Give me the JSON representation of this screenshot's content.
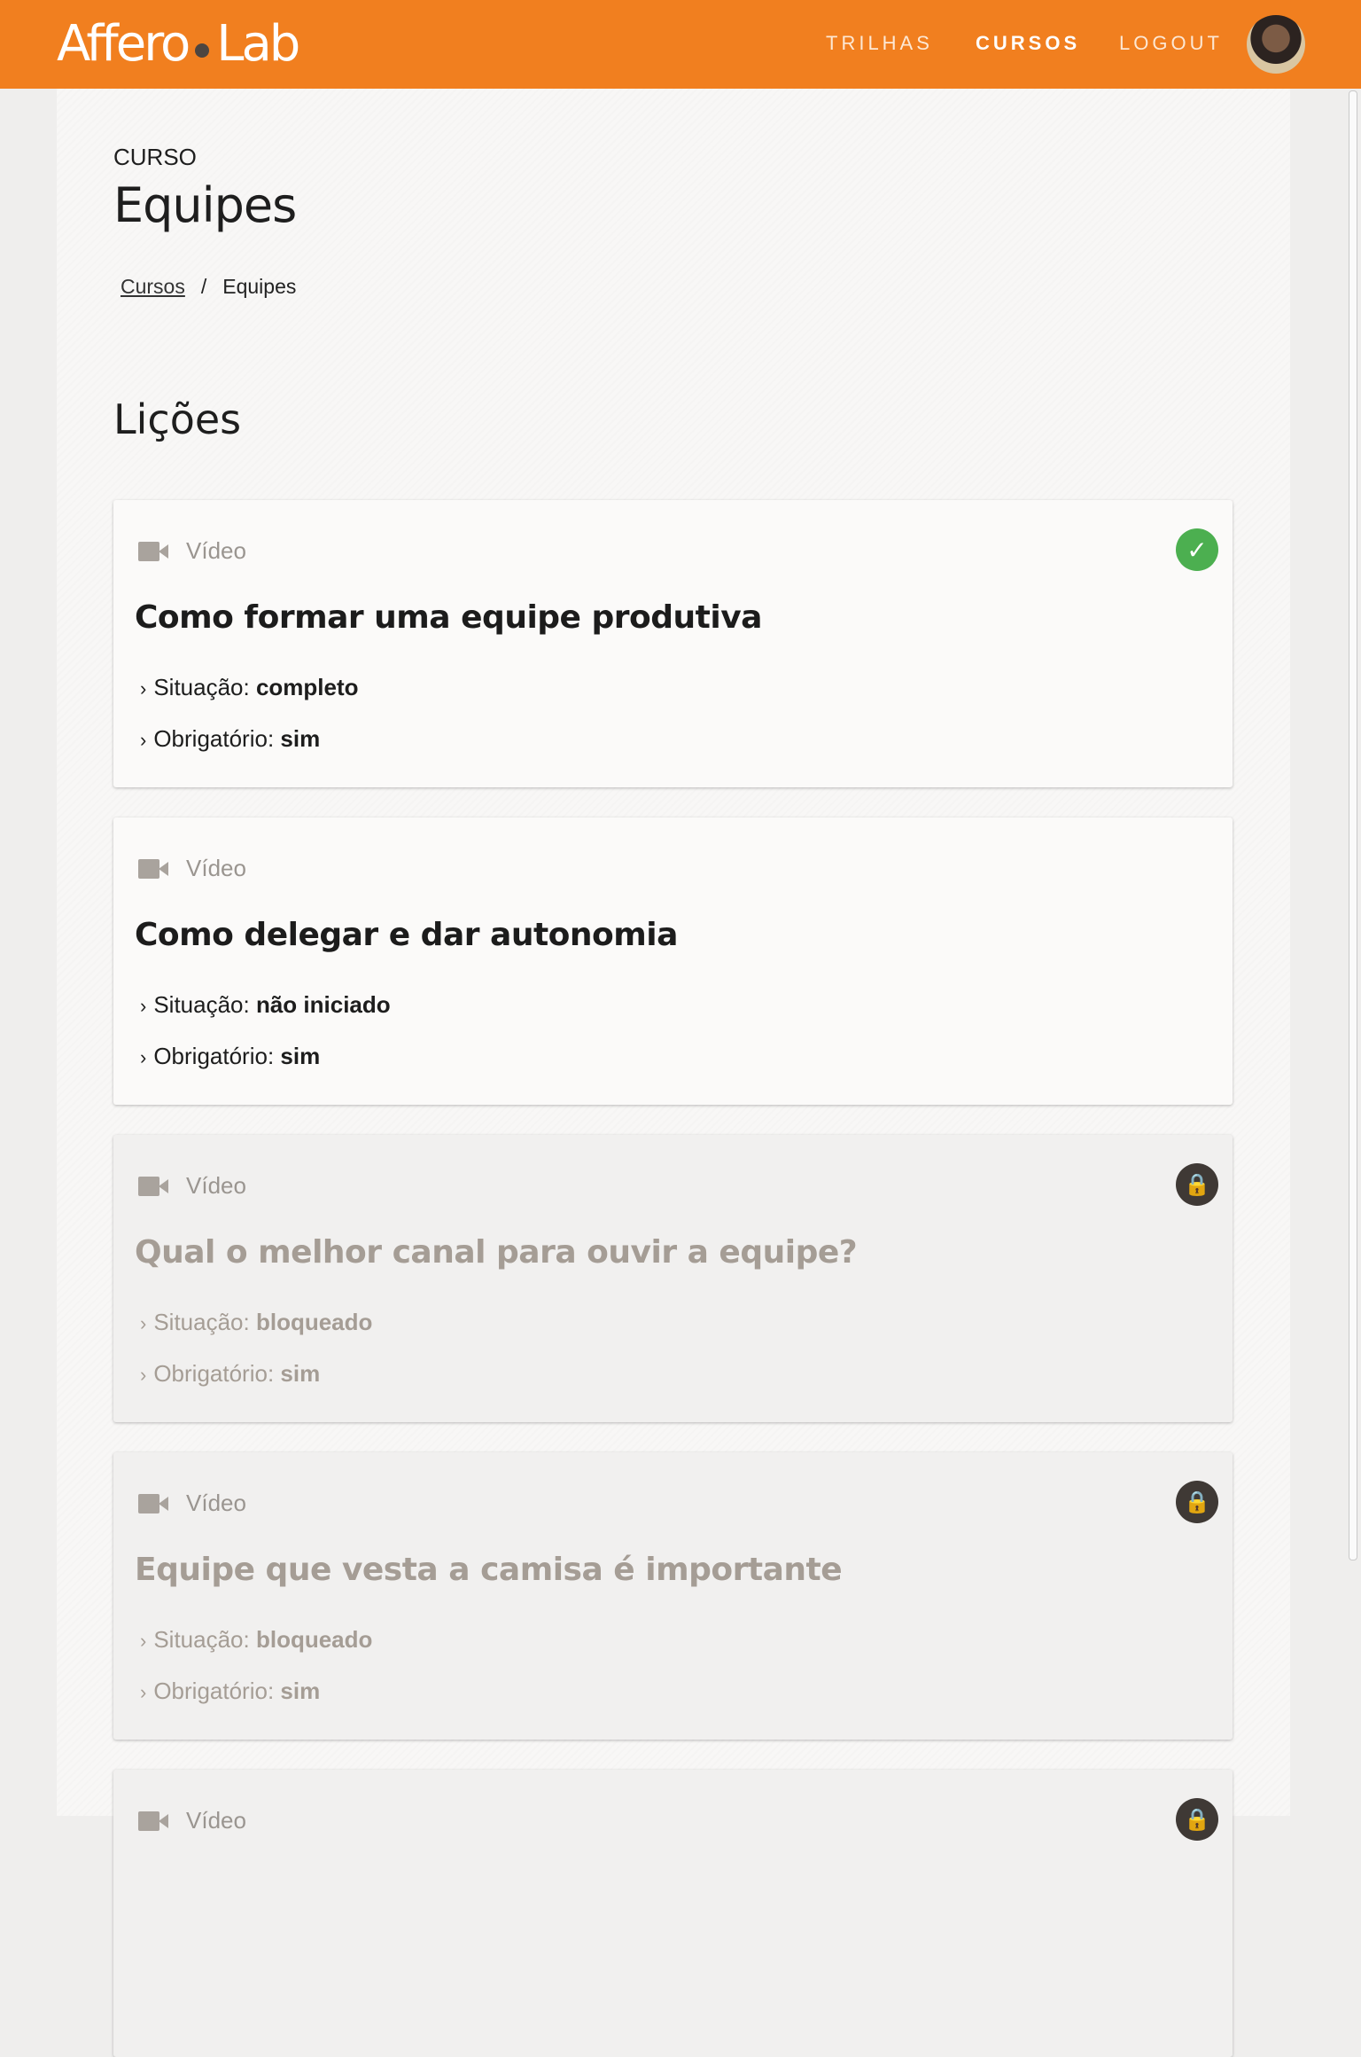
{
  "header": {
    "logo_left": "Affero",
    "logo_right": "Lab",
    "nav": [
      {
        "label": "TRILHAS",
        "active": false
      },
      {
        "label": "CURSOS",
        "active": true
      },
      {
        "label": "LOGOUT",
        "active": false
      }
    ]
  },
  "page": {
    "eyebrow": "CURSO",
    "title": "Equipes",
    "breadcrumb": {
      "link": "Cursos",
      "separator": "/",
      "current": "Equipes"
    },
    "section_title": "Lições"
  },
  "lessons": [
    {
      "type": "Vídeo",
      "title": "Como formar uma equipe produtiva",
      "status_label": "Situação:",
      "status": "completo",
      "required_label": "Obrigatório:",
      "required": "sim",
      "icon": "check-icon",
      "locked": false
    },
    {
      "type": "Vídeo",
      "title": "Como delegar e dar autonomia",
      "status_label": "Situação:",
      "status": "não iniciado",
      "required_label": "Obrigatório:",
      "required": "sim",
      "icon": "",
      "locked": false
    },
    {
      "type": "Vídeo",
      "title": "Qual o melhor canal para ouvir a equipe?",
      "status_label": "Situação:",
      "status": "bloqueado",
      "required_label": "Obrigatório:",
      "required": "sim",
      "icon": "lock-icon",
      "locked": true
    },
    {
      "type": "Vídeo",
      "title": "Equipe que vesta a camisa é importante",
      "status_label": "Situação:",
      "status": "bloqueado",
      "required_label": "Obrigatório:",
      "required": "sim",
      "icon": "lock-icon",
      "locked": true
    },
    {
      "type": "Vídeo",
      "title": "",
      "status_label": "",
      "status": "",
      "required_label": "",
      "required": "",
      "icon": "lock-icon",
      "locked": true
    }
  ],
  "colors": {
    "brand": "#f17f1f",
    "success": "#4caf50",
    "lock": "#3f3935"
  }
}
